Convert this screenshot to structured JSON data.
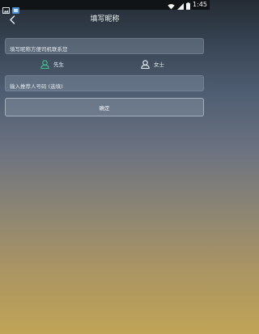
{
  "status_bar": {
    "time": "1:45",
    "left_icons": [
      "image-icon",
      "app-notification-icon"
    ],
    "right_icons": [
      "wifi-icon",
      "signal-icon",
      "battery-icon"
    ]
  },
  "header": {
    "title": "填写昵称",
    "back_icon": "chevron-left-icon"
  },
  "form": {
    "nickname_placeholder": "填写昵称方便司机联系您",
    "gender": {
      "male_label": "先生",
      "female_label": "女士",
      "male_color": "#3fc28a",
      "female_color": "#e8edf2"
    },
    "referral_placeholder": "输入推荐人号码 (选填)",
    "confirm_label": "确定"
  }
}
